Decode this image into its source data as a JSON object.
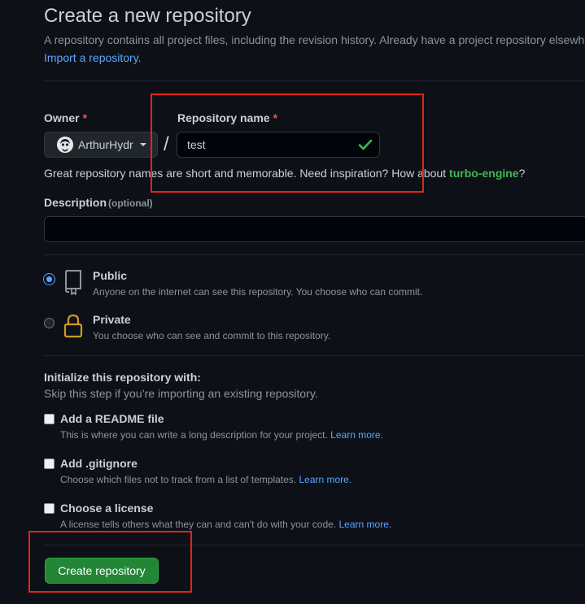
{
  "header": {
    "title": "Create a new repository",
    "lead": "A repository contains all project files, including the revision history. Already have a project repository elsewhere?",
    "import_link": "Import a repository."
  },
  "owner": {
    "label": "Owner",
    "required_mark": "*",
    "value": "ArthurHydr"
  },
  "repo_name": {
    "label": "Repository name",
    "required_mark": "*",
    "value": "test",
    "valid": true
  },
  "slash": "/",
  "hint": {
    "text": "Great repository names are short and memorable. Need inspiration? How about ",
    "suggestion": "turbo-engine",
    "suffix": "?"
  },
  "description": {
    "label": "Description",
    "optional": "(optional)",
    "value": ""
  },
  "visibility": {
    "selected": "public",
    "options": [
      {
        "id": "public",
        "title": "Public",
        "desc": "Anyone on the internet can see this repository. You choose who can commit.",
        "icon": "repo-icon"
      },
      {
        "id": "private",
        "title": "Private",
        "desc": "You choose who can see and commit to this repository.",
        "icon": "lock-icon"
      }
    ]
  },
  "init": {
    "title": "Initialize this repository with:",
    "subtitle": "Skip this step if you’re importing an existing repository.",
    "options": [
      {
        "title": "Add a README file",
        "desc": "This is where you can write a long description for your project.",
        "link": "Learn more.",
        "checked": false
      },
      {
        "title": "Add .gitignore",
        "desc": "Choose which files not to track from a list of templates.",
        "link": "Learn more.",
        "checked": false
      },
      {
        "title": "Choose a license",
        "desc": "A license tells others what they can and can't do with your code.",
        "link": "Learn more.",
        "checked": false
      }
    ]
  },
  "submit": {
    "label": "Create repository"
  },
  "colors": {
    "background": "#0d1117",
    "accent_green": "#238636",
    "link_blue": "#58a6ff",
    "required_red": "#f85149",
    "highlight_red": "#e3221c"
  }
}
